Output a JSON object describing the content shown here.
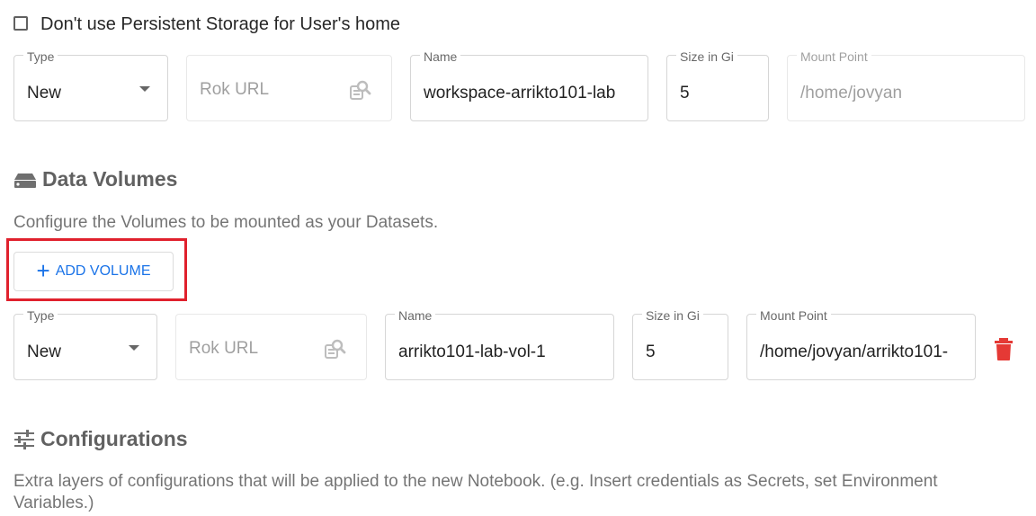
{
  "workspace": {
    "checkbox_label": "Don't use Persistent Storage for User's home",
    "checked": false,
    "type": {
      "label": "Type",
      "value": "New"
    },
    "rok_url": {
      "placeholder": "Rok URL"
    },
    "name": {
      "label": "Name",
      "value": "workspace-arrikto101-lab"
    },
    "size": {
      "label": "Size in Gi",
      "value": "5"
    },
    "mount": {
      "label": "Mount Point",
      "value": "/home/jovyan"
    }
  },
  "data_volumes": {
    "title": "Data Volumes",
    "description": "Configure the Volumes to be mounted as your Datasets.",
    "add_button_label": "ADD VOLUME",
    "volumes": [
      {
        "type": {
          "label": "Type",
          "value": "New"
        },
        "rok_url": {
          "placeholder": "Rok URL"
        },
        "name": {
          "label": "Name",
          "value": "arrikto101-lab-vol-1"
        },
        "size": {
          "label": "Size in Gi",
          "value": "5"
        },
        "mount": {
          "label": "Mount Point",
          "value": "/home/jovyan/arrikto101-"
        }
      }
    ]
  },
  "configurations": {
    "title": "Configurations",
    "description": "Extra layers of configurations that will be applied to the new Notebook. (e.g. Insert credentials as Secrets, set Environment Variables.)"
  },
  "colors": {
    "accent": "#1a73e8",
    "delete": "#e53935",
    "highlight": "#e0212d"
  },
  "icons": [
    "checkbox-icon",
    "dropdown-arrow-icon",
    "rok-search-icon",
    "storage-icon",
    "tune-icon",
    "plus-icon",
    "delete-icon"
  ]
}
